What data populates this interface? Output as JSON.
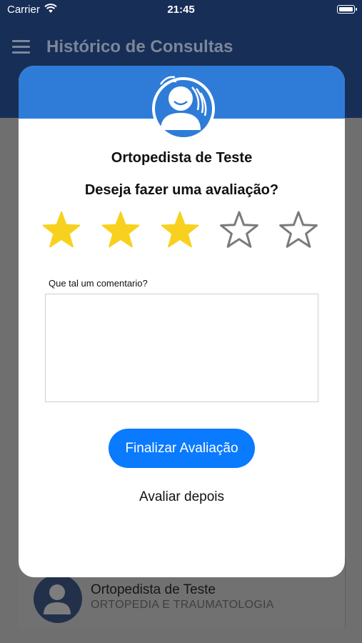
{
  "status_bar": {
    "carrier": "Carrier",
    "time": "21:45"
  },
  "navbar": {
    "title": "Histórico de Consultas"
  },
  "modal": {
    "doctor_name": "Ortopedista de Teste",
    "question": "Deseja fazer uma avaliação?",
    "rating": {
      "value": 3,
      "max": 5,
      "filled_color": "#f7d11e",
      "empty_color": "#7a7a7a"
    },
    "comment_label": "Que tal um comentario?",
    "comment_value": "",
    "submit_label": "Finalizar Avaliação",
    "later_label": "Avaliar depois"
  },
  "background_list": {
    "item": {
      "name": "Ortopedista de Teste",
      "specialty": "ORTOPEDIA E TRAUMATOLOGIA"
    }
  },
  "colors": {
    "header_blue": "#2f7cd8",
    "nav_bg": "#172e57",
    "button_blue": "#0a7aff"
  },
  "icons": [
    "wifi-icon",
    "battery-icon",
    "menu-icon",
    "doctor-avatar-icon",
    "star-icon"
  ]
}
